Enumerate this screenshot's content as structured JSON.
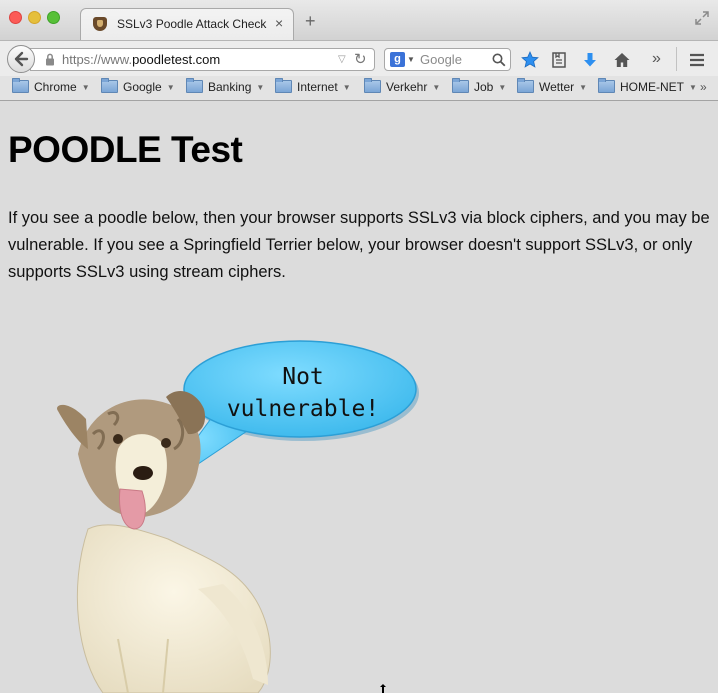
{
  "browser": {
    "tab": {
      "title": "SSLv3 Poodle Attack Check",
      "close_label": "×"
    },
    "new_tab_label": "+",
    "url": {
      "scheme": "https://www.",
      "host": "poodletest.com"
    },
    "search": {
      "engine_letter": "g",
      "placeholder": "Google"
    },
    "bookmarks": [
      {
        "label": "Chrome"
      },
      {
        "label": "Google"
      },
      {
        "label": "Banking"
      },
      {
        "label": "Internet"
      },
      {
        "label": "Verkehr"
      },
      {
        "label": "Job"
      },
      {
        "label": "Wetter"
      },
      {
        "label": "HOME-NET"
      }
    ],
    "overflow_label": "»",
    "accent_color": "#2d8ff0"
  },
  "page": {
    "title": "POODLE Test",
    "intro": "If you see a poodle below, then your browser supports SSLv3 via block ciphers, and you may be vulnerable. If you see a Springfield Terrier below, your browser doesn't support SSLv3, or only supports SSLv3 using stream ciphers.",
    "bubble": {
      "line1": "Not",
      "line2": "vulnerable!"
    },
    "bubble_color": "#4fc6f2"
  }
}
